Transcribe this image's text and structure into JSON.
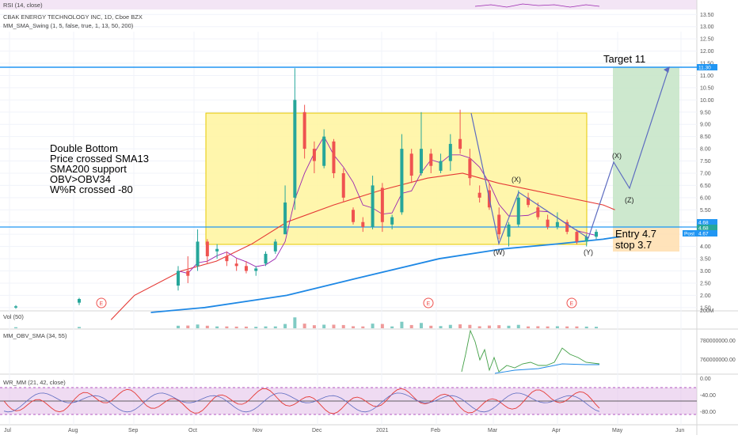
{
  "header": {
    "title": "CBAK ENERGY TECHNOLOGY INC, 1D, Cboe BZX",
    "rsi_legend": "RSI (14, close)",
    "swing_legend": "MM_SMA_Swing (1, 5, false, true, 1, 13, 50, 200)"
  },
  "legends": {
    "vol": "Vol (50)",
    "obv": "MM_OBV_SMA (34, 55)",
    "wr": "WR_MM (21, 42, close)"
  },
  "price_axis": {
    "ticks": [
      "13.50",
      "13.00",
      "12.50",
      "12.00",
      "11.50",
      "11.00",
      "10.50",
      "10.00",
      "9.50",
      "9.00",
      "8.50",
      "8.00",
      "7.50",
      "7.00",
      "6.50",
      "6.00",
      "5.50",
      "5.00",
      "4.50",
      "4.00",
      "3.50",
      "3.00",
      "2.50",
      "2.00",
      "1.50"
    ],
    "badges": [
      {
        "text": "11.30",
        "color": "#2196f3"
      },
      {
        "text": "4.68",
        "color": "#2196f3"
      },
      {
        "text": "4.68",
        "color": "#26a69a"
      },
      {
        "text": "Post",
        "color": "#2196f3"
      },
      {
        "text": "4.67",
        "color": "#2196f3"
      }
    ]
  },
  "vol_axis": {
    "ticks": [
      "200M"
    ]
  },
  "obv_axis": {
    "ticks": [
      "780000000.00",
      "760000000.00"
    ]
  },
  "wr_axis": {
    "ticks": [
      "0.00",
      "-40.00",
      "-80.00"
    ]
  },
  "time_axis": [
    "Jul",
    "Aug",
    "Sep",
    "Oct",
    "Nov",
    "Dec",
    "2021",
    "Feb",
    "Mar",
    "Apr",
    "May",
    "Jun"
  ],
  "annotations": {
    "notes": [
      "Double Bottom",
      "Price crossed SMA13",
      "SMA200 support",
      "OBV>OBV34",
      "W%R crossed -80"
    ],
    "target": "Target 11",
    "entry": "Entry 4.7",
    "stop": "stop 3.7",
    "wave_labels": [
      "(W)",
      "(X)",
      "(Y)",
      "(X)",
      "(Z)"
    ],
    "earnings_marker": "E"
  },
  "colors": {
    "up": "#26a69a",
    "down": "#ef5350",
    "sma_fast": "#9c27b0",
    "sma_mid": "#e53935",
    "sma_slow": "#1e88e5",
    "level_line": "#2196f3",
    "zone": "#fff59d",
    "target_zone": "#c8e6c9",
    "stop_zone": "#ffe0b2"
  },
  "chart_data": {
    "type": "candlestick",
    "title": "CBAK ENERGY TECHNOLOGY INC, 1D, Cboe BZX",
    "y_range": [
      1.3,
      13.8
    ],
    "levels": {
      "resistance": 11.3,
      "support": 4.68,
      "entry": 4.7,
      "stop": 3.7,
      "target": 11
    },
    "candles": [
      {
        "d": "Jul",
        "o": 1.5,
        "h": 1.6,
        "l": 1.45,
        "c": 1.55
      },
      {
        "d": "Sep",
        "o": 1.7,
        "h": 1.9,
        "l": 1.6,
        "c": 1.85
      },
      {
        "d": "late Sep",
        "o": 2.4,
        "h": 3.2,
        "l": 2.2,
        "c": 3.0
      },
      {
        "d": "late Sep",
        "o": 3.0,
        "h": 3.6,
        "l": 2.5,
        "c": 2.8
      },
      {
        "d": "Oct",
        "o": 3.2,
        "h": 4.7,
        "l": 3.0,
        "c": 4.2
      },
      {
        "d": "Oct",
        "o": 4.2,
        "h": 4.3,
        "l": 3.3,
        "c": 3.6
      },
      {
        "d": "Oct",
        "o": 3.8,
        "h": 4.1,
        "l": 3.5,
        "c": 3.9
      },
      {
        "d": "Oct",
        "o": 3.6,
        "h": 3.8,
        "l": 3.2,
        "c": 3.4
      },
      {
        "d": "Oct",
        "o": 3.3,
        "h": 3.5,
        "l": 3.0,
        "c": 3.2
      },
      {
        "d": "Oct",
        "o": 3.2,
        "h": 3.4,
        "l": 2.9,
        "c": 3.0
      },
      {
        "d": "Nov",
        "o": 3.0,
        "h": 3.2,
        "l": 2.8,
        "c": 3.1
      },
      {
        "d": "Nov",
        "o": 3.3,
        "h": 3.8,
        "l": 3.2,
        "c": 3.7
      },
      {
        "d": "Nov",
        "o": 3.8,
        "h": 4.3,
        "l": 3.7,
        "c": 4.2
      },
      {
        "d": "Nov",
        "o": 4.5,
        "h": 6.5,
        "l": 4.5,
        "c": 5.8
      },
      {
        "d": "Nov",
        "o": 6.0,
        "h": 11.3,
        "l": 5.5,
        "c": 10.0
      },
      {
        "d": "Nov",
        "o": 9.5,
        "h": 9.8,
        "l": 7.6,
        "c": 8.0
      },
      {
        "d": "Nov",
        "o": 8.0,
        "h": 8.3,
        "l": 7.0,
        "c": 7.5
      },
      {
        "d": "Dec",
        "o": 7.3,
        "h": 8.8,
        "l": 7.2,
        "c": 8.5
      },
      {
        "d": "Dec",
        "o": 8.3,
        "h": 8.4,
        "l": 6.8,
        "c": 7.0
      },
      {
        "d": "Dec",
        "o": 7.0,
        "h": 7.2,
        "l": 5.8,
        "c": 6.0
      },
      {
        "d": "Dec",
        "o": 5.5,
        "h": 5.6,
        "l": 4.9,
        "c": 5.0
      },
      {
        "d": "Dec",
        "o": 5.0,
        "h": 5.2,
        "l": 4.6,
        "c": 4.8
      },
      {
        "d": "Dec",
        "o": 4.8,
        "h": 6.9,
        "l": 4.7,
        "c": 6.5
      },
      {
        "d": "Dec",
        "o": 6.4,
        "h": 6.6,
        "l": 4.6,
        "c": 5.0
      },
      {
        "d": "2021",
        "o": 4.9,
        "h": 5.3,
        "l": 4.7,
        "c": 5.2
      },
      {
        "d": "Jan",
        "o": 5.4,
        "h": 8.6,
        "l": 5.3,
        "c": 8.0
      },
      {
        "d": "Jan",
        "o": 7.8,
        "h": 8.0,
        "l": 6.6,
        "c": 6.9
      },
      {
        "d": "Jan",
        "o": 7.0,
        "h": 9.5,
        "l": 6.9,
        "c": 8.0
      },
      {
        "d": "Jan",
        "o": 7.8,
        "h": 8.0,
        "l": 7.0,
        "c": 7.3
      },
      {
        "d": "Feb",
        "o": 7.1,
        "h": 7.8,
        "l": 7.0,
        "c": 7.5
      },
      {
        "d": "Feb",
        "o": 7.5,
        "h": 8.6,
        "l": 7.1,
        "c": 8.2
      },
      {
        "d": "Feb",
        "o": 8.4,
        "h": 9.6,
        "l": 7.8,
        "c": 8.0
      },
      {
        "d": "Feb",
        "o": 7.6,
        "h": 8.0,
        "l": 6.5,
        "c": 6.8
      },
      {
        "d": "Feb",
        "o": 6.2,
        "h": 6.5,
        "l": 5.8,
        "c": 6.0
      },
      {
        "d": "Mar",
        "o": 6.3,
        "h": 6.6,
        "l": 5.5,
        "c": 5.6
      },
      {
        "d": "Mar",
        "o": 5.3,
        "h": 5.6,
        "l": 4.3,
        "c": 4.5
      },
      {
        "d": "Mar",
        "o": 4.4,
        "h": 5.0,
        "l": 4.0,
        "c": 4.9
      },
      {
        "d": "Mar",
        "o": 4.9,
        "h": 6.3,
        "l": 4.8,
        "c": 6.0
      },
      {
        "d": "Mar",
        "o": 6.0,
        "h": 6.2,
        "l": 5.6,
        "c": 5.7
      },
      {
        "d": "Mar",
        "o": 5.6,
        "h": 5.8,
        "l": 5.1,
        "c": 5.2
      },
      {
        "d": "Apr",
        "o": 5.1,
        "h": 5.3,
        "l": 4.7,
        "c": 4.8
      },
      {
        "d": "Apr",
        "o": 4.8,
        "h": 5.4,
        "l": 4.7,
        "c": 5.0
      },
      {
        "d": "Apr",
        "o": 5.0,
        "h": 5.1,
        "l": 4.5,
        "c": 4.6
      },
      {
        "d": "Apr",
        "o": 4.6,
        "h": 4.7,
        "l": 4.1,
        "c": 4.2
      },
      {
        "d": "Apr",
        "o": 4.2,
        "h": 4.5,
        "l": 4.0,
        "c": 4.4
      },
      {
        "d": "Apr",
        "o": 4.4,
        "h": 4.7,
        "l": 4.3,
        "c": 4.6
      }
    ],
    "sma200": [
      [
        0.62,
        1.3
      ],
      [
        0.85,
        1.5
      ],
      [
        1.2,
        2.0
      ],
      [
        1.5,
        2.7
      ],
      [
        1.85,
        3.5
      ],
      [
        2.12,
        3.9
      ],
      [
        2.35,
        4.1
      ],
      [
        2.55,
        4.3
      ],
      [
        2.62,
        4.4
      ]
    ],
    "sma50": [
      [
        0.45,
        1.0
      ],
      [
        0.55,
        2.0
      ],
      [
        0.75,
        3.0
      ],
      [
        0.9,
        3.4
      ],
      [
        1.05,
        4.1
      ],
      [
        1.2,
        5.0
      ],
      [
        1.4,
        5.7
      ],
      [
        1.6,
        6.3
      ],
      [
        1.8,
        6.8
      ],
      [
        1.95,
        7.0
      ],
      [
        2.1,
        6.6
      ],
      [
        2.25,
        6.3
      ],
      [
        2.4,
        6.0
      ],
      [
        2.55,
        5.7
      ],
      [
        2.6,
        5.5
      ]
    ]
  }
}
